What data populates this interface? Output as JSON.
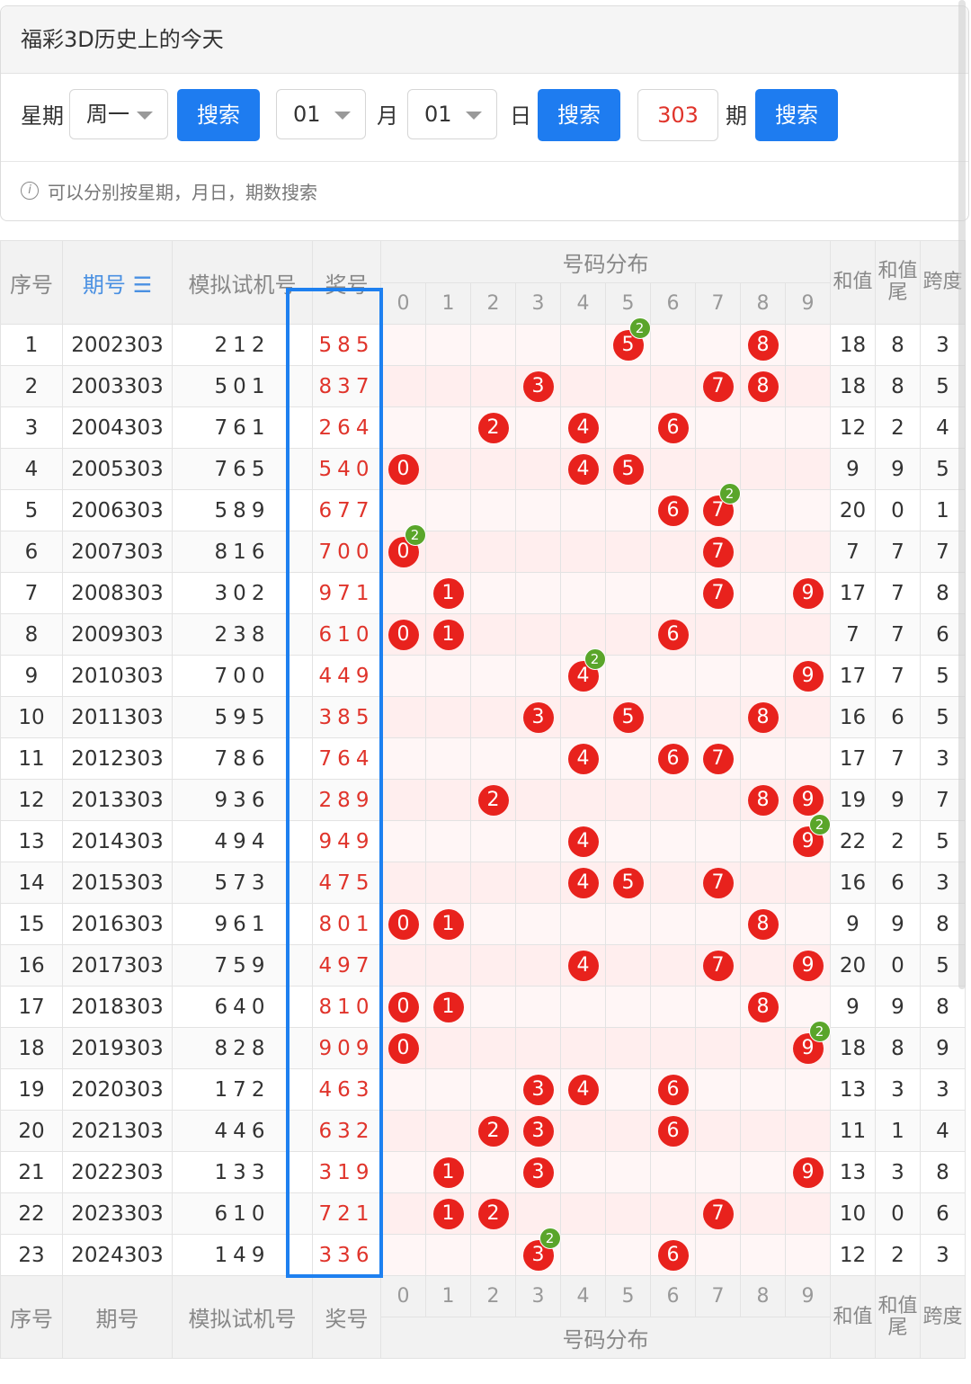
{
  "title": "福彩3D历史上的今天",
  "search": {
    "week_label": "星期",
    "week_value": "周一",
    "search_btn": "搜索",
    "month_value": "01",
    "month_label": "月",
    "day_value": "01",
    "day_label": "日",
    "period_value": "303",
    "period_label": "期",
    "hint_icon": "i",
    "hint": "可以分别按星期，月日，期数搜索"
  },
  "table": {
    "headers": {
      "index": "序号",
      "issue": "期号",
      "issue_sort_icon": "☰",
      "trial": "模拟试机号",
      "award": "奖号",
      "distribution": "号码分布",
      "digits": [
        "0",
        "1",
        "2",
        "3",
        "4",
        "5",
        "6",
        "7",
        "8",
        "9"
      ],
      "sum": "和值",
      "sum_tail": "和值尾",
      "span": "跨度"
    },
    "rows": [
      {
        "idx": "1",
        "issue": "2002303",
        "trial": "212",
        "award": "585",
        "sum": "18",
        "tail": "8",
        "span": "3"
      },
      {
        "idx": "2",
        "issue": "2003303",
        "trial": "501",
        "award": "837",
        "sum": "18",
        "tail": "8",
        "span": "5"
      },
      {
        "idx": "3",
        "issue": "2004303",
        "trial": "761",
        "award": "264",
        "sum": "12",
        "tail": "2",
        "span": "4"
      },
      {
        "idx": "4",
        "issue": "2005303",
        "trial": "765",
        "award": "540",
        "sum": "9",
        "tail": "9",
        "span": "5"
      },
      {
        "idx": "5",
        "issue": "2006303",
        "trial": "589",
        "award": "677",
        "sum": "20",
        "tail": "0",
        "span": "1"
      },
      {
        "idx": "6",
        "issue": "2007303",
        "trial": "816",
        "award": "700",
        "sum": "7",
        "tail": "7",
        "span": "7"
      },
      {
        "idx": "7",
        "issue": "2008303",
        "trial": "302",
        "award": "971",
        "sum": "17",
        "tail": "7",
        "span": "8"
      },
      {
        "idx": "8",
        "issue": "2009303",
        "trial": "238",
        "award": "610",
        "sum": "7",
        "tail": "7",
        "span": "6"
      },
      {
        "idx": "9",
        "issue": "2010303",
        "trial": "700",
        "award": "449",
        "sum": "17",
        "tail": "7",
        "span": "5"
      },
      {
        "idx": "10",
        "issue": "2011303",
        "trial": "595",
        "award": "385",
        "sum": "16",
        "tail": "6",
        "span": "5"
      },
      {
        "idx": "11",
        "issue": "2012303",
        "trial": "786",
        "award": "764",
        "sum": "17",
        "tail": "7",
        "span": "3"
      },
      {
        "idx": "12",
        "issue": "2013303",
        "trial": "936",
        "award": "289",
        "sum": "19",
        "tail": "9",
        "span": "7"
      },
      {
        "idx": "13",
        "issue": "2014303",
        "trial": "494",
        "award": "949",
        "sum": "22",
        "tail": "2",
        "span": "5"
      },
      {
        "idx": "14",
        "issue": "2015303",
        "trial": "573",
        "award": "475",
        "sum": "16",
        "tail": "6",
        "span": "3"
      },
      {
        "idx": "15",
        "issue": "2016303",
        "trial": "961",
        "award": "801",
        "sum": "9",
        "tail": "9",
        "span": "8"
      },
      {
        "idx": "16",
        "issue": "2017303",
        "trial": "759",
        "award": "497",
        "sum": "20",
        "tail": "0",
        "span": "5"
      },
      {
        "idx": "17",
        "issue": "2018303",
        "trial": "640",
        "award": "810",
        "sum": "9",
        "tail": "9",
        "span": "8"
      },
      {
        "idx": "18",
        "issue": "2019303",
        "trial": "828",
        "award": "909",
        "sum": "18",
        "tail": "8",
        "span": "9"
      },
      {
        "idx": "19",
        "issue": "2020303",
        "trial": "172",
        "award": "463",
        "sum": "13",
        "tail": "3",
        "span": "3"
      },
      {
        "idx": "20",
        "issue": "2021303",
        "trial": "446",
        "award": "632",
        "sum": "11",
        "tail": "1",
        "span": "4"
      },
      {
        "idx": "21",
        "issue": "2022303",
        "trial": "133",
        "award": "319",
        "sum": "13",
        "tail": "3",
        "span": "8"
      },
      {
        "idx": "22",
        "issue": "2023303",
        "trial": "610",
        "award": "721",
        "sum": "10",
        "tail": "0",
        "span": "6"
      },
      {
        "idx": "23",
        "issue": "2024303",
        "trial": "149",
        "award": "336",
        "sum": "12",
        "tail": "2",
        "span": "3"
      }
    ]
  },
  "colors": {
    "accent": "#1e7cf0",
    "ball": "#e8221d",
    "repeat_badge": "#5aa52a",
    "award_text": "#e0342b",
    "highlight_box": "#1e80f0"
  }
}
